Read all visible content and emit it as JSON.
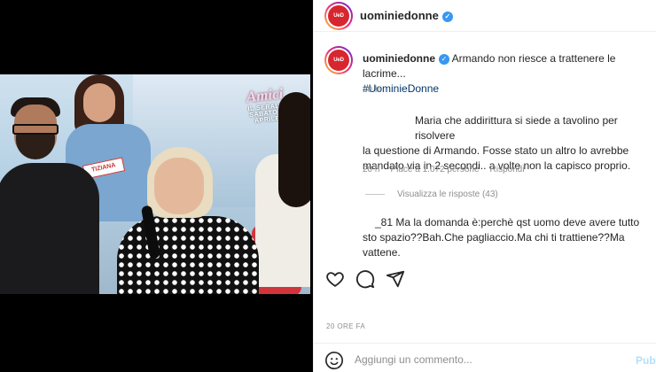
{
  "header": {
    "username": "uominiedonne",
    "avatar_text": "UeD"
  },
  "video": {
    "logo_main": "Amici",
    "logo_sub_1": "IL SERALE",
    "logo_sub_2": "SABATO 1 APRILE",
    "name_tag": "TIZIANA"
  },
  "caption": {
    "username": "uominiedonne",
    "text": "Armando non riesce a trattenere le lacrime...",
    "hashtag": "#UominieDonne",
    "time": "20 h"
  },
  "comment1": {
    "line1": "Maria che addirittura si siede a tavolino per risolvere",
    "line2": "la questione di Armando. Fosse stato un altro lo avrebbe",
    "line3": "mandato via in 2 secondi.. a volte non la capisco proprio.",
    "time": "20 h",
    "likes": "Piace a 1.072 persone",
    "reply": "Rispondi"
  },
  "replies": {
    "label": "Visualizza le risposte (43)"
  },
  "comment2": {
    "line1": "_81 Ma la domanda è:perchè qst uomo deve avere tutto",
    "line2": "sto spazio??Bah.Che pagliaccio.Ma chi ti trattiene??Ma vattene."
  },
  "actions": {
    "like_icon": "heart-icon",
    "comment_icon": "speech-bubble-icon",
    "share_icon": "paper-plane-icon"
  },
  "post": {
    "timestamp": "20 ORE FA"
  },
  "comment_bar": {
    "placeholder": "Aggiungi un commento...",
    "publish": "Pub"
  },
  "colors": {
    "verified": "#3897f0",
    "brand_red": "#d7262f",
    "link": "#00376b",
    "muted": "#8e8e8e"
  }
}
